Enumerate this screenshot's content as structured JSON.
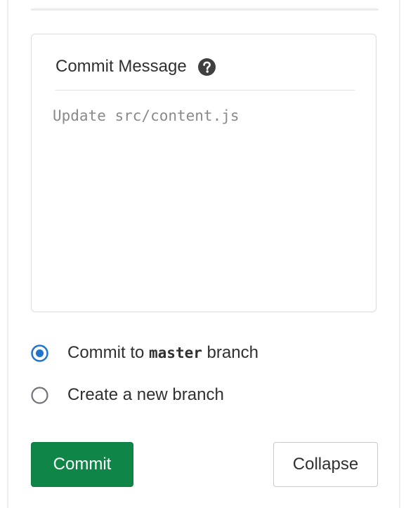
{
  "commit_box": {
    "label": "Commit Message",
    "help_icon": "question-circle-icon",
    "textarea_value": "",
    "textarea_placeholder": "Update src/content.js"
  },
  "branch_options": [
    {
      "label_prefix": "Commit to ",
      "branch": "master",
      "label_suffix": " branch",
      "selected": true
    },
    {
      "label": "Create a new branch",
      "selected": false
    }
  ],
  "buttons": {
    "commit": "Commit",
    "collapse": "Collapse"
  },
  "colors": {
    "primary_green": "#108548",
    "radio_selected": "#1f75cb",
    "text": "#303030",
    "placeholder": "#8a8a8a",
    "border": "#dcdcde"
  }
}
